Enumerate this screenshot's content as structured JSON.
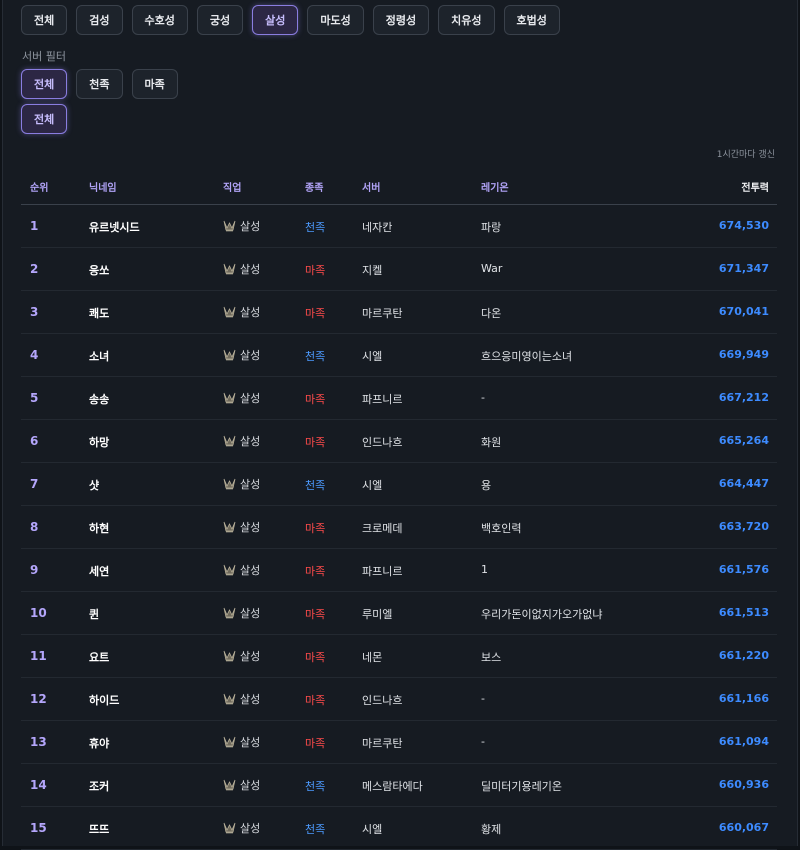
{
  "class_tabs": [
    {
      "label": "전체",
      "active": false
    },
    {
      "label": "검성",
      "active": false
    },
    {
      "label": "수호성",
      "active": false
    },
    {
      "label": "궁성",
      "active": false
    },
    {
      "label": "살성",
      "active": true
    },
    {
      "label": "마도성",
      "active": false
    },
    {
      "label": "정령성",
      "active": false
    },
    {
      "label": "치유성",
      "active": false
    },
    {
      "label": "호법성",
      "active": false
    }
  ],
  "server_filter": {
    "label": "서버 필터",
    "race_options": [
      {
        "label": "전체",
        "active": true
      },
      {
        "label": "천족",
        "active": false
      },
      {
        "label": "마족",
        "active": false
      }
    ],
    "server_options": [
      {
        "label": "전체",
        "active": true
      }
    ]
  },
  "update_note": "1시간마다 갱신",
  "table": {
    "headers": {
      "rank": "순위",
      "name": "닉네임",
      "job": "직업",
      "race": "종족",
      "server": "서버",
      "legion": "레기온",
      "power": "전투력"
    },
    "rows": [
      {
        "rank": "1",
        "name": "유르넷시드",
        "job": "살성",
        "race": "천족",
        "server": "네자칸",
        "legion": "파랑",
        "power": "674,530"
      },
      {
        "rank": "2",
        "name": "응쏘",
        "job": "살성",
        "race": "마족",
        "server": "지켈",
        "legion": "War",
        "power": "671,347"
      },
      {
        "rank": "3",
        "name": "쾌도",
        "job": "살성",
        "race": "마족",
        "server": "마르쿠탄",
        "legion": "다온",
        "power": "670,041"
      },
      {
        "rank": "4",
        "name": "소녀",
        "job": "살성",
        "race": "천족",
        "server": "시엘",
        "legion": "흐으응미영이는소녀",
        "power": "669,949"
      },
      {
        "rank": "5",
        "name": "송송",
        "job": "살성",
        "race": "마족",
        "server": "파프니르",
        "legion": "-",
        "power": "667,212"
      },
      {
        "rank": "6",
        "name": "하망",
        "job": "살성",
        "race": "마족",
        "server": "인드나흐",
        "legion": "화원",
        "power": "665,264"
      },
      {
        "rank": "7",
        "name": "샷",
        "job": "살성",
        "race": "천족",
        "server": "시엘",
        "legion": "용",
        "power": "664,447"
      },
      {
        "rank": "8",
        "name": "하현",
        "job": "살성",
        "race": "마족",
        "server": "크로메데",
        "legion": "백호인력",
        "power": "663,720"
      },
      {
        "rank": "9",
        "name": "세연",
        "job": "살성",
        "race": "마족",
        "server": "파프니르",
        "legion": "1",
        "power": "661,576"
      },
      {
        "rank": "10",
        "name": "퀸",
        "job": "살성",
        "race": "마족",
        "server": "루미엘",
        "legion": "우리가돈이없지가오가없냐",
        "power": "661,513"
      },
      {
        "rank": "11",
        "name": "요트",
        "job": "살성",
        "race": "마족",
        "server": "네몬",
        "legion": "보스",
        "power": "661,220"
      },
      {
        "rank": "12",
        "name": "하이드",
        "job": "살성",
        "race": "마족",
        "server": "인드나흐",
        "legion": "-",
        "power": "661,166"
      },
      {
        "rank": "13",
        "name": "휴야",
        "job": "살성",
        "race": "마족",
        "server": "마르쿠탄",
        "legion": "-",
        "power": "661,094"
      },
      {
        "rank": "14",
        "name": "조커",
        "job": "살성",
        "race": "천족",
        "server": "메스람타에다",
        "legion": "딜미터기용레기온",
        "power": "660,936"
      },
      {
        "rank": "15",
        "name": "뜨뜨",
        "job": "살성",
        "race": "천족",
        "server": "시엘",
        "legion": "황제",
        "power": "660,067"
      }
    ]
  },
  "colors": {
    "accent": "#8a7de0",
    "race_cheon": "#4c9bff",
    "race_ma": "#ff4b4b",
    "power": "#3d8bff"
  },
  "icons": {
    "job": "assassin-class-icon"
  }
}
